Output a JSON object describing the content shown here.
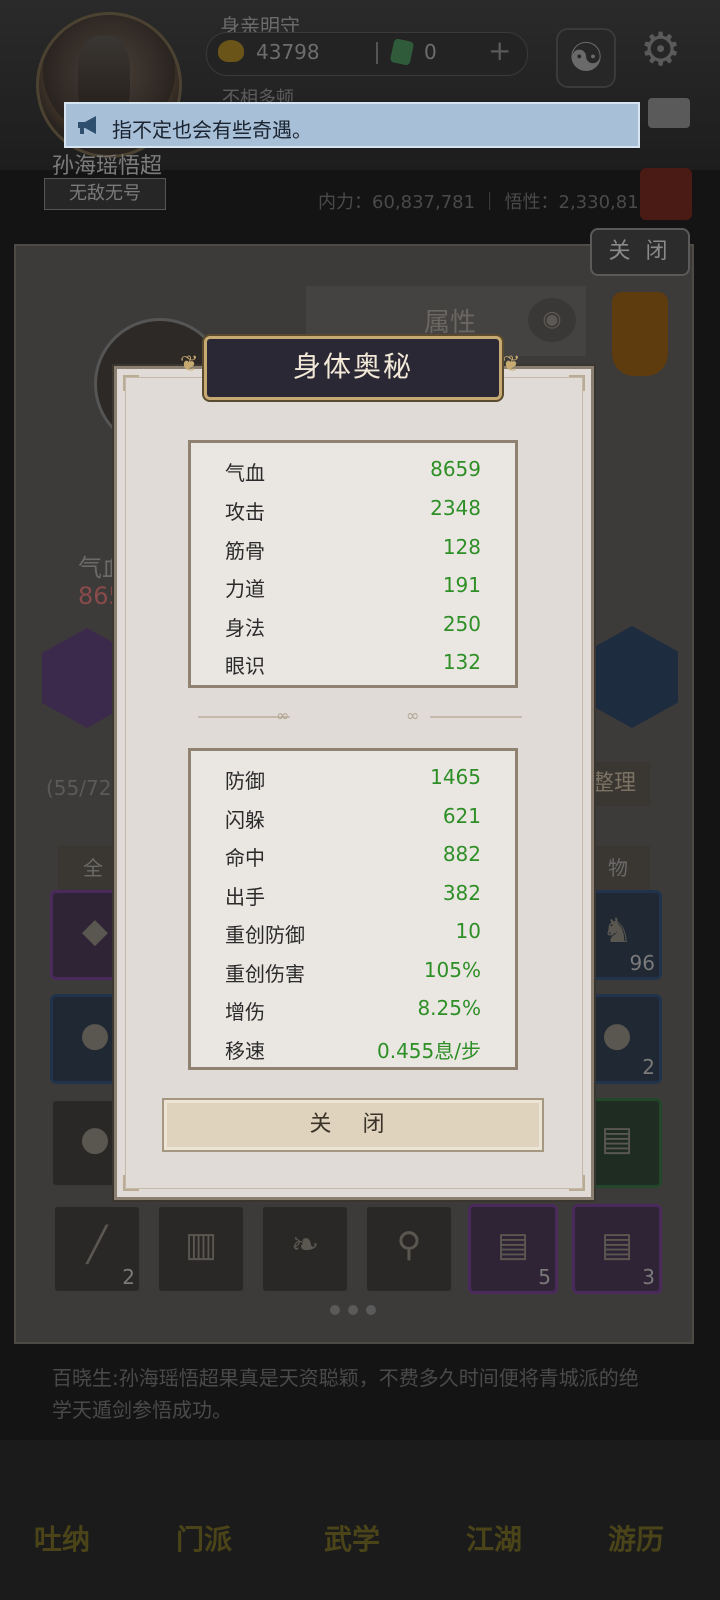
{
  "toast": {
    "text": "指不定也会有些奇遇。",
    "icon": "megaphone-icon"
  },
  "modal": {
    "title": "身体奥秘",
    "group1": [
      {
        "name": "气血",
        "value": "8659"
      },
      {
        "name": "攻击",
        "value": "2348"
      },
      {
        "name": "筋骨",
        "value": "128"
      },
      {
        "name": "力道",
        "value": "191"
      },
      {
        "name": "身法",
        "value": "250"
      },
      {
        "name": "眼识",
        "value": "132"
      }
    ],
    "group2": [
      {
        "name": "防御",
        "value": "1465"
      },
      {
        "name": "闪躲",
        "value": "621"
      },
      {
        "name": "命中",
        "value": "882"
      },
      {
        "name": "出手",
        "value": "382"
      },
      {
        "name": "重创防御",
        "value": "10"
      },
      {
        "name": "重创伤害",
        "value": "105%"
      },
      {
        "name": "增伤",
        "value": "8.25%"
      },
      {
        "name": "移速",
        "value": "0.455息/步"
      }
    ],
    "close_label": "关 闭",
    "value_color": "#2e8f26"
  },
  "background": {
    "player_name": "身亲明守",
    "coins": "43798",
    "jade": "0",
    "plus": "+",
    "sub_line": "不相多顿",
    "nickname": "孙海瑶悟超",
    "title_tag": "无敌无号",
    "stats": "内力：60,837,781 ｜ 悟性：2,330,811",
    "panel_close": "关 闭",
    "attr_label": "属性",
    "hp_label": "气血",
    "hp_value": "865",
    "bag_count": "(55/72)",
    "sort_label": "整理",
    "filter_all": "全",
    "filter_item": "物",
    "slot_counts": [
      "96",
      "2",
      "2",
      "5",
      "3"
    ],
    "log_line1": "百晓生:孙海瑶悟超果真是天资聪颖，不费多久时间便将青城派的绝",
    "log_line2": "学天遁剑参悟成功。",
    "nav": [
      "吐纳",
      "门派",
      "武学",
      "江湖",
      "游历"
    ]
  }
}
